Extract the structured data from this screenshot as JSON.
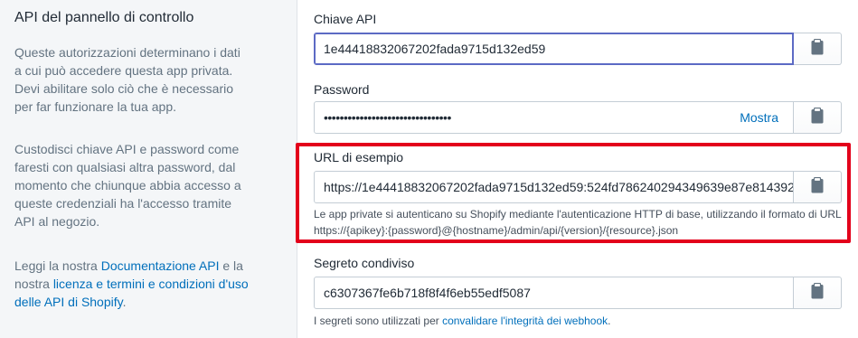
{
  "left": {
    "title": "API del pannello di controllo",
    "p1": "Queste autorizzazioni determinano i dati a cui può accedere questa app privata. Devi abilitare solo ciò che è necessario per far funzionare la tua app.",
    "p2": "Custodisci chiave API e password come faresti con qualsiasi altra password, dal momento che chiunque abbia accesso a queste credenziali ha l'accesso tramite API al negozio.",
    "p3_before": "Leggi la nostra ",
    "p3_link1": "Documentazione API",
    "p3_mid": " e la nostra ",
    "p3_link2": "licenza e termini e condizioni d'uso delle API di Shopify",
    "p3_after": "."
  },
  "fields": {
    "api_key": {
      "label": "Chiave API",
      "value": "1e44418832067202fada9715d132ed59"
    },
    "password": {
      "label": "Password",
      "value": "••••••••••••••••••••••••••••••••",
      "show_label": "Mostra"
    },
    "example_url": {
      "label": "URL di esempio",
      "value": "https://1e44418832067202fada9715d132ed59:524fd786240294349639e87e814392",
      "help_line1": "Le app private si autenticano su Shopify mediante l'autenticazione HTTP di base, utilizzando il formato di URL",
      "help_line2": "https://{apikey}:{password}@{hostname}/admin/api/{version}/{resource}.json"
    },
    "shared_secret": {
      "label": "Segreto condiviso",
      "value": "c6307367fe6b718f8f4f6eb55edf5087",
      "help_before": "I segreti sono utilizzati per ",
      "help_link": "convalidare l'integrità dei webhook",
      "help_after": "."
    }
  },
  "icons": {
    "copy": "clipboard-icon"
  },
  "colors": {
    "accent": "#006fbb",
    "focus": "#5c6ac4",
    "highlight": "#e3001b"
  }
}
